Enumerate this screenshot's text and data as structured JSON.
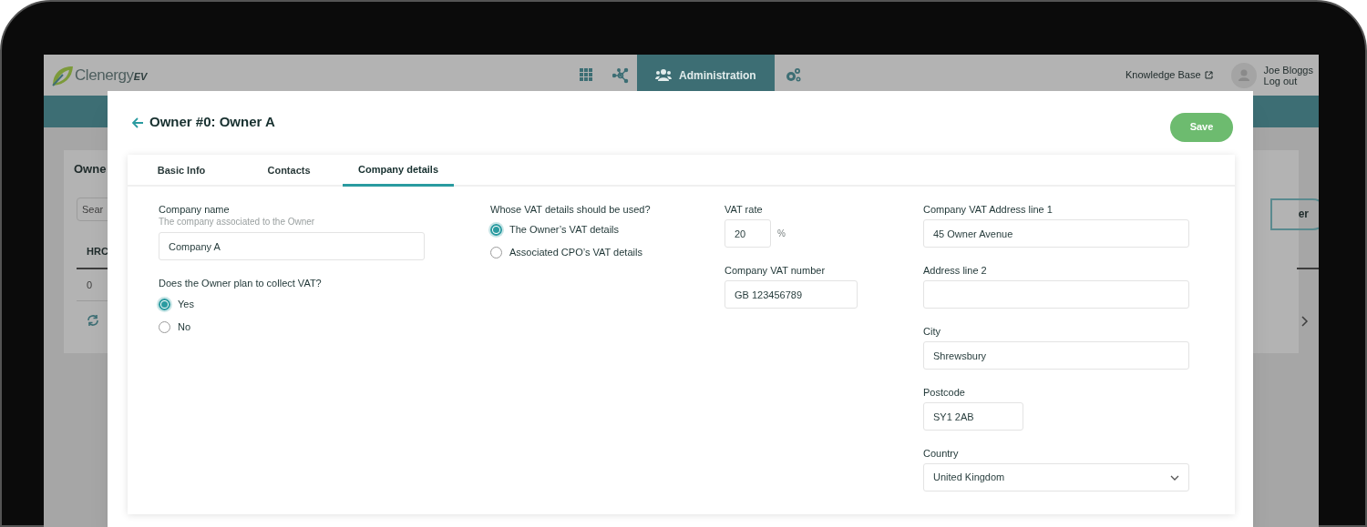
{
  "app": {
    "logo": {
      "text": "Clenergy",
      "suffix": "EV"
    },
    "nav_items": [
      {
        "selected": false
      },
      {
        "selected": false
      },
      {
        "label": "Administration",
        "selected": true
      },
      {
        "selected": false
      }
    ],
    "help_link": "Knowledge Base",
    "user": {
      "name": "Joe Bloggs",
      "action": "Log out"
    }
  },
  "background_page": {
    "card_title": "Owne",
    "search_placeholder": "Sear",
    "column_1": "HRC",
    "cell": "0",
    "button": "er"
  },
  "modal": {
    "title": "Owner #0: Owner A",
    "save_button": "Save",
    "tabs": [
      {
        "label": "Basic Info",
        "selected": false
      },
      {
        "label": "Contacts",
        "selected": false
      },
      {
        "label": "Company details",
        "selected": true
      }
    ],
    "columns": [
      [
        {
          "kind": "text",
          "label": "Company name",
          "hint": "The company associated to the Owner",
          "value": "Company A"
        },
        {
          "kind": "radio",
          "label": "Does the Owner plan to collect VAT?",
          "options": [
            {
              "label": "Yes",
              "selected": true
            },
            {
              "label": "No",
              "selected": false
            }
          ]
        }
      ],
      [
        {
          "kind": "radio",
          "label": "Whose VAT details should be used?",
          "options": [
            {
              "label": "The Owner’s VAT details",
              "selected": true
            },
            {
              "label": "Associated CPO’s VAT details",
              "selected": false
            }
          ]
        }
      ],
      [
        {
          "kind": "short_text",
          "label": "VAT rate",
          "value": "20",
          "suffix": "%"
        },
        {
          "kind": "text",
          "label": "Company VAT number",
          "value": "GB 123456789"
        }
      ],
      [
        {
          "kind": "text",
          "label": "Company VAT Address line 1",
          "value": "45 Owner Avenue"
        },
        {
          "kind": "text",
          "label": "Address line 2"
        },
        {
          "kind": "text",
          "label": "City",
          "value": "Shrewsbury"
        },
        {
          "kind": "short_text",
          "label": "Postcode",
          "value": "SY1 2AB"
        },
        {
          "kind": "select",
          "label": "Country",
          "value": "United Kingdom"
        }
      ]
    ]
  }
}
